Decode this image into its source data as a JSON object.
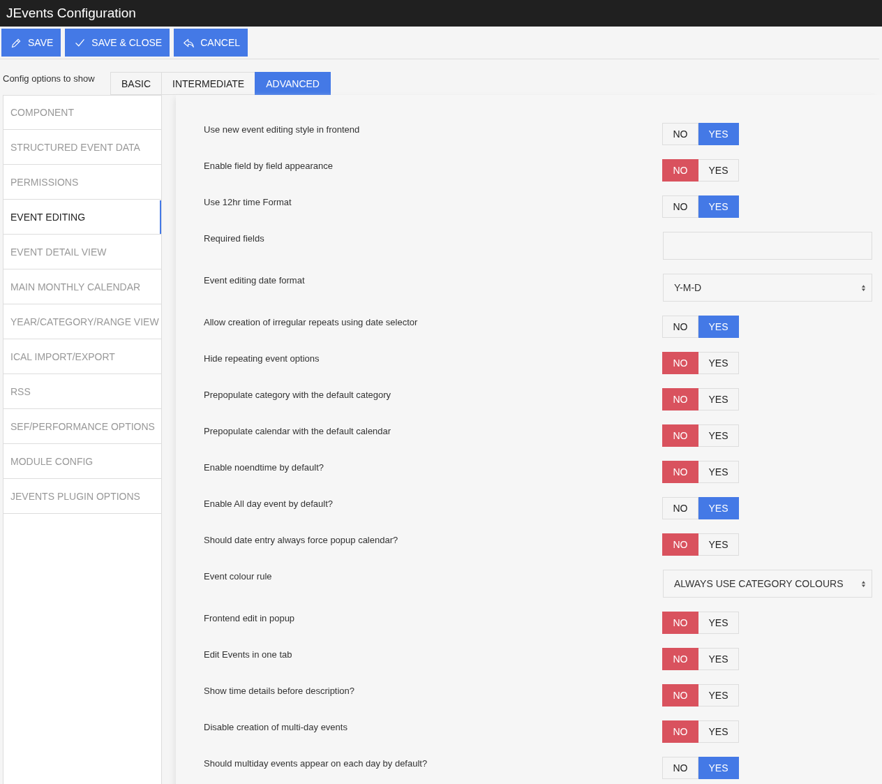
{
  "window": {
    "title": "JEvents Configuration"
  },
  "toolbar": [
    {
      "label": "SAVE",
      "kind": "save"
    },
    {
      "label": "SAVE & CLOSE",
      "kind": "save-close"
    },
    {
      "label": "CANCEL",
      "kind": "cancel"
    }
  ],
  "config_level": {
    "label": "Config options to show",
    "tabs": [
      {
        "label": "BASIC",
        "selected": false
      },
      {
        "label": "INTERMEDIATE",
        "selected": false
      },
      {
        "label": "ADVANCED",
        "selected": true
      }
    ]
  },
  "sidebar": {
    "items": [
      {
        "label": "COMPONENT",
        "selected": false
      },
      {
        "label": "STRUCTURED EVENT DATA",
        "selected": false
      },
      {
        "label": "PERMISSIONS",
        "selected": false
      },
      {
        "label": "EVENT EDITING",
        "selected": true
      },
      {
        "label": "EVENT DETAIL VIEW",
        "selected": false
      },
      {
        "label": "MAIN MONTHLY CALENDAR",
        "selected": false
      },
      {
        "label": "YEAR/CATEGORY/RANGE VIEW",
        "selected": false
      },
      {
        "label": "ICAL IMPORT/EXPORT",
        "selected": false
      },
      {
        "label": "RSS",
        "selected": false
      },
      {
        "label": "SEF/PERFORMANCE OPTIONS",
        "selected": false
      },
      {
        "label": "MODULE CONFIG",
        "selected": false
      },
      {
        "label": "JEVENTS PLUGIN OPTIONS",
        "selected": false
      }
    ]
  },
  "settings": [
    {
      "kind": "toggle",
      "label": "Use new event editing style in frontend",
      "options": [
        {
          "label": "NO",
          "selected": false
        },
        {
          "label": "YES",
          "selected": true
        }
      ]
    },
    {
      "kind": "toggle",
      "label": "Enable field by field appearance",
      "options": [
        {
          "label": "NO",
          "selected": true
        },
        {
          "label": "YES",
          "selected": false
        }
      ]
    },
    {
      "kind": "toggle",
      "label": "Use 12hr time Format",
      "options": [
        {
          "label": "NO",
          "selected": false
        },
        {
          "label": "YES",
          "selected": true
        }
      ]
    },
    {
      "kind": "text",
      "label": "Required fields"
    },
    {
      "kind": "select",
      "label": "Event editing date format",
      "value": "Y-M-D"
    },
    {
      "kind": "toggle",
      "label": "Allow creation of irregular repeats using date selector",
      "options": [
        {
          "label": "NO",
          "selected": false
        },
        {
          "label": "YES",
          "selected": true
        }
      ]
    },
    {
      "kind": "toggle",
      "label": "Hide repeating event options",
      "options": [
        {
          "label": "NO",
          "selected": true
        },
        {
          "label": "YES",
          "selected": false
        }
      ]
    },
    {
      "kind": "toggle",
      "label": "Prepopulate category with the default category",
      "options": [
        {
          "label": "NO",
          "selected": true
        },
        {
          "label": "YES",
          "selected": false
        }
      ]
    },
    {
      "kind": "toggle",
      "label": "Prepopulate calendar with the default calendar",
      "options": [
        {
          "label": "NO",
          "selected": true
        },
        {
          "label": "YES",
          "selected": false
        }
      ]
    },
    {
      "kind": "toggle",
      "label": "Enable noendtime by default?",
      "options": [
        {
          "label": "NO",
          "selected": true
        },
        {
          "label": "YES",
          "selected": false
        }
      ]
    },
    {
      "kind": "toggle",
      "label": "Enable All day event by default?",
      "options": [
        {
          "label": "NO",
          "selected": false
        },
        {
          "label": "YES",
          "selected": true
        }
      ]
    },
    {
      "kind": "toggle",
      "label": "Should date entry always force popup calendar?",
      "options": [
        {
          "label": "NO",
          "selected": true
        },
        {
          "label": "YES",
          "selected": false
        }
      ]
    },
    {
      "kind": "select",
      "label": "Event colour rule",
      "value": "ALWAYS USE CATEGORY COLOURS"
    },
    {
      "kind": "toggle",
      "label": "Frontend edit in popup",
      "options": [
        {
          "label": "NO",
          "selected": true
        },
        {
          "label": "YES",
          "selected": false
        }
      ]
    },
    {
      "kind": "toggle",
      "label": "Edit Events in one tab",
      "options": [
        {
          "label": "NO",
          "selected": true
        },
        {
          "label": "YES",
          "selected": false
        }
      ]
    },
    {
      "kind": "toggle",
      "label": "Show time details before description?",
      "options": [
        {
          "label": "NO",
          "selected": true
        },
        {
          "label": "YES",
          "selected": false
        }
      ]
    },
    {
      "kind": "toggle",
      "label": "Disable creation of multi-day events",
      "options": [
        {
          "label": "NO",
          "selected": true
        },
        {
          "label": "YES",
          "selected": false
        }
      ]
    },
    {
      "kind": "toggle",
      "label": "Should multiday events appear on each day by default?",
      "options": [
        {
          "label": "NO",
          "selected": false
        },
        {
          "label": "YES",
          "selected": true
        }
      ]
    }
  ]
}
